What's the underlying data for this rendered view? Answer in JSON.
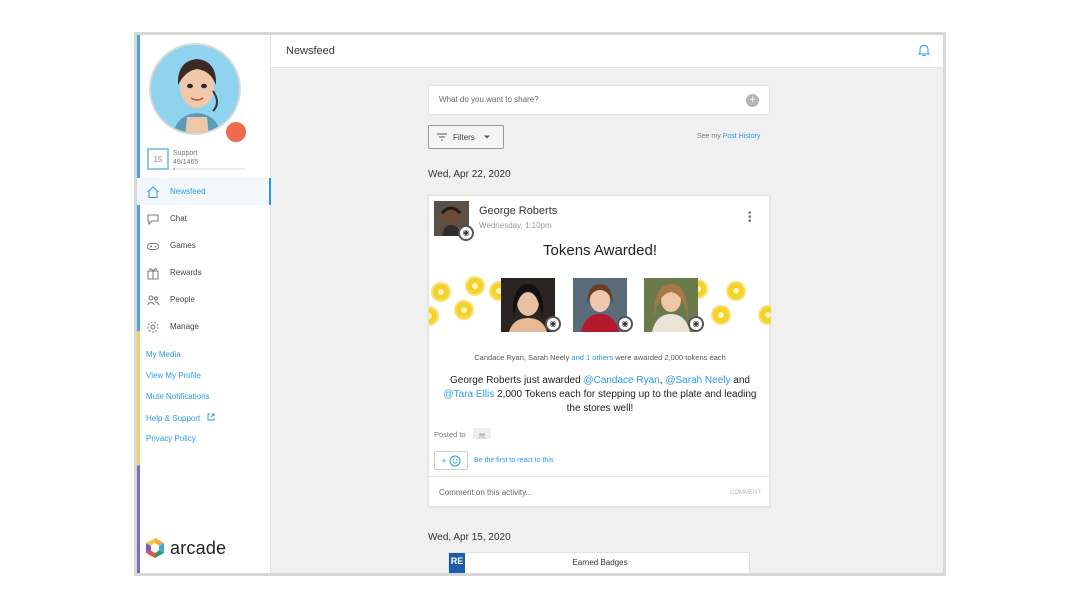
{
  "app": {
    "brand": "arcade",
    "page_title": "Newsfeed"
  },
  "profile": {
    "level": "15",
    "team": "Support",
    "progress": "49/1465",
    "progress_fraction": 0.033
  },
  "nav": [
    {
      "label": "Newsfeed",
      "icon": "home-icon",
      "active": true
    },
    {
      "label": "Chat",
      "icon": "chat-icon",
      "active": false
    },
    {
      "label": "Games",
      "icon": "gamepad-icon",
      "active": false
    },
    {
      "label": "Rewards",
      "icon": "gift-icon",
      "active": false
    },
    {
      "label": "People",
      "icon": "people-icon",
      "active": false
    },
    {
      "label": "Manage",
      "icon": "gear-icon",
      "active": false
    }
  ],
  "links": [
    "My Media",
    "View My Profile",
    "Mute Notifications",
    "Help & Support",
    "Privacy Policy"
  ],
  "feed": {
    "share_placeholder": "What do you want to share?",
    "filters_label": "Filters",
    "see_my": "See my",
    "post_history": "Post History",
    "date_1": "Wed, Apr 22, 2020",
    "date_2": "Wed, Apr 15, 2020"
  },
  "post": {
    "author": "George Roberts",
    "time": "Wednesday, 1:10pm",
    "title": "Tokens Awarded!",
    "awarded_names": "Candace Ryan, Sarah Neely",
    "awarded_others": "and 1 others",
    "awarded_suffix": "were awarded 2,000 tokens each",
    "body_lead": "George Roberts just awarded",
    "mention_1": "@Candace Ryan",
    "comma": ",",
    "mention_2": "@Sarah Neely",
    "and_word": "and",
    "mention_3": "@Tara Ellis",
    "body_tail": "2,000 Tokens each for stepping up to the plate and leading the stores well!",
    "posted_to": "Posted to",
    "react_label": "+",
    "react_prompt": "Be the first to react to this",
    "comment_placeholder": "Comment on this activity...",
    "comment_button": "COMMENT"
  },
  "post2": {
    "title": "Earned Badges",
    "tag": "RE"
  },
  "colors": {
    "accent": "#2b9be0",
    "coin": "#f4d22c",
    "avatar_bg": "#8fd3ef"
  }
}
